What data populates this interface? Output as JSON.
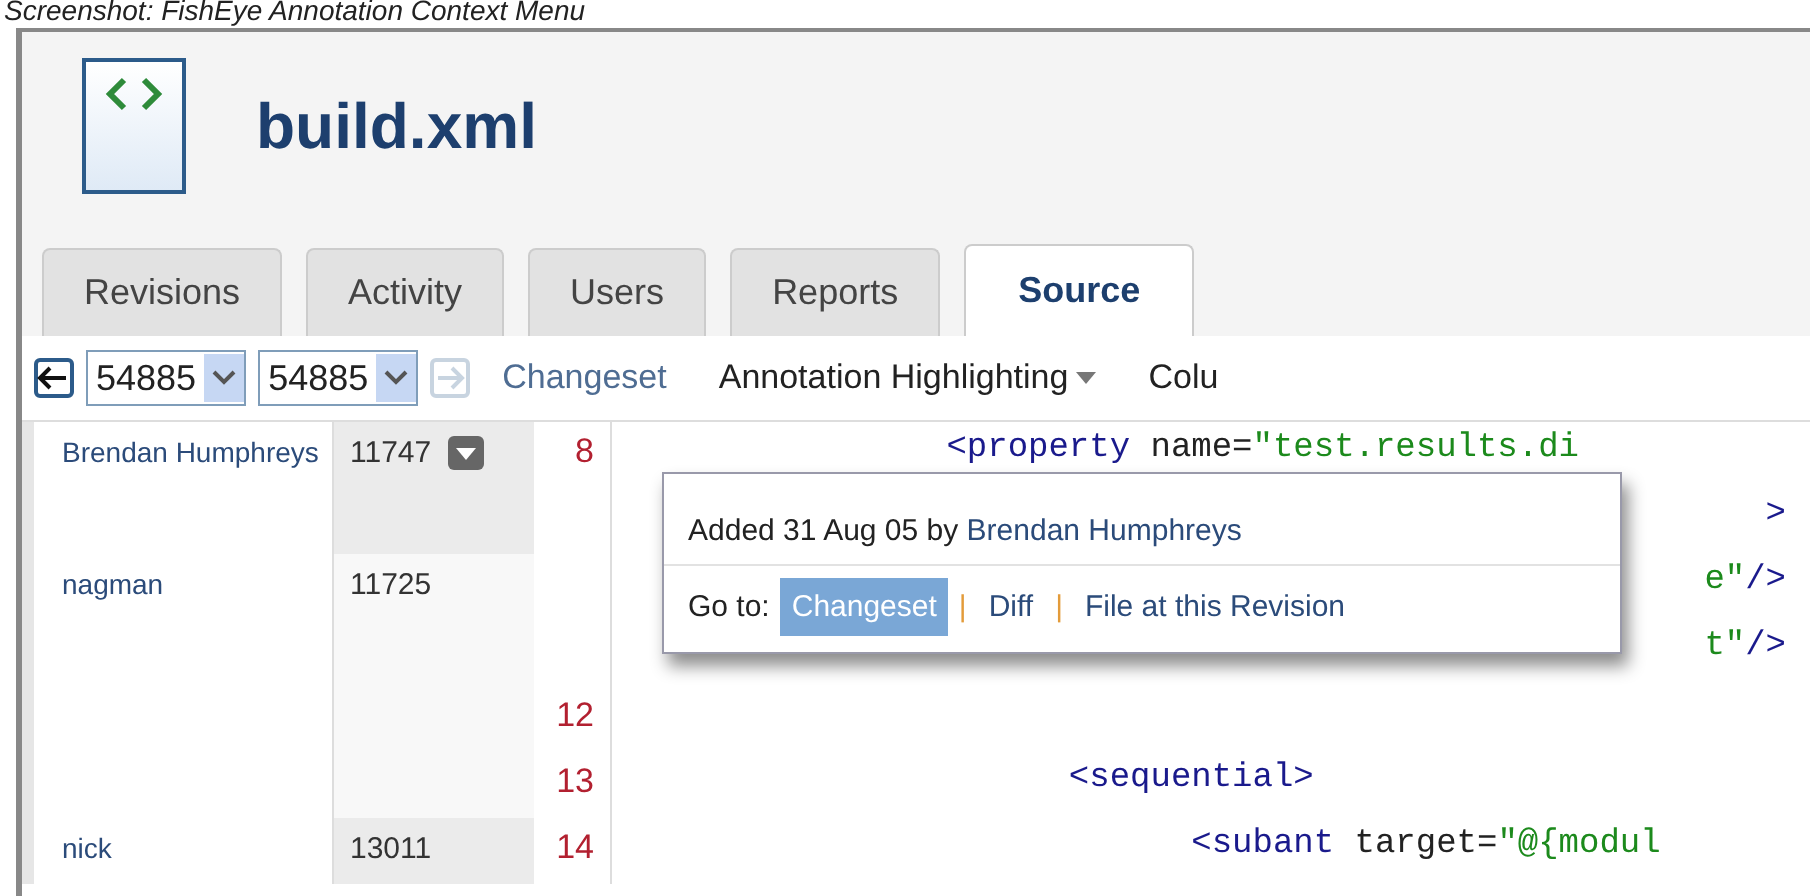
{
  "caption": "Screenshot: FishEye Annotation Context Menu",
  "header": {
    "title": "build.xml"
  },
  "tabs": [
    {
      "label": "Revisions",
      "selected": false
    },
    {
      "label": "Activity",
      "selected": false
    },
    {
      "label": "Users",
      "selected": false
    },
    {
      "label": "Reports",
      "selected": false
    },
    {
      "label": "Source",
      "selected": true
    }
  ],
  "toolbar": {
    "back": {
      "disabled": false
    },
    "from_revision": "54885",
    "to_revision": "54885",
    "forward": {
      "disabled": true
    },
    "items": [
      {
        "label": "Changeset",
        "kind": "link"
      },
      {
        "label": "Annotation Highlighting",
        "kind": "dropdown"
      },
      {
        "label": "Colu",
        "kind": "dropdown-cut"
      }
    ]
  },
  "annotations": [
    {
      "author": "Brendan Humphreys",
      "revision": "11747",
      "menu_button": true,
      "shaded": true,
      "lines": [
        {
          "number": "8",
          "kind": "full",
          "code": [
            {
              "text": "                <property",
              "kind": "tag"
            },
            {
              "text": " name=",
              "kind": "attr"
            },
            {
              "text": "\"test.results.di",
              "kind": "value"
            }
          ]
        },
        {
          "kind": "partial",
          "code": [
            {
              "text": ">",
              "kind": "tag"
            }
          ]
        }
      ]
    },
    {
      "author": "nagman",
      "revision": "11725",
      "menu_button": false,
      "shaded": false,
      "lines": [
        {
          "kind": "partial",
          "code": [
            {
              "text": "e\"",
              "kind": "value"
            },
            {
              "text": "/>",
              "kind": "tag"
            }
          ]
        },
        {
          "kind": "partial",
          "code": [
            {
              "text": "t\"",
              "kind": "value"
            },
            {
              "text": "/>",
              "kind": "tag"
            }
          ]
        },
        {
          "number": "12",
          "kind": "full"
        },
        {
          "number": "13",
          "kind": "full",
          "code": [
            {
              "text": "                      <sequential>",
              "kind": "tag"
            }
          ]
        }
      ]
    },
    {
      "author": "nick",
      "revision": "13011",
      "menu_button": false,
      "shaded": true,
      "lines": [
        {
          "number": "14",
          "kind": "full",
          "code": [
            {
              "text": "                            <subant",
              "kind": "tag"
            },
            {
              "text": " target=",
              "kind": "attr"
            },
            {
              "text": "\"@{modul",
              "kind": "value"
            }
          ]
        }
      ]
    }
  ],
  "popup": {
    "added": "Added 31 Aug 05 by",
    "author": "Brendan Humphreys",
    "goto_label": "Go to:",
    "separators": [
      "|",
      "|"
    ],
    "links": [
      {
        "label": "Changeset",
        "selected": true
      },
      {
        "label": "Diff",
        "selected": false
      },
      {
        "label": "File at this Revision",
        "selected": false
      }
    ]
  }
}
